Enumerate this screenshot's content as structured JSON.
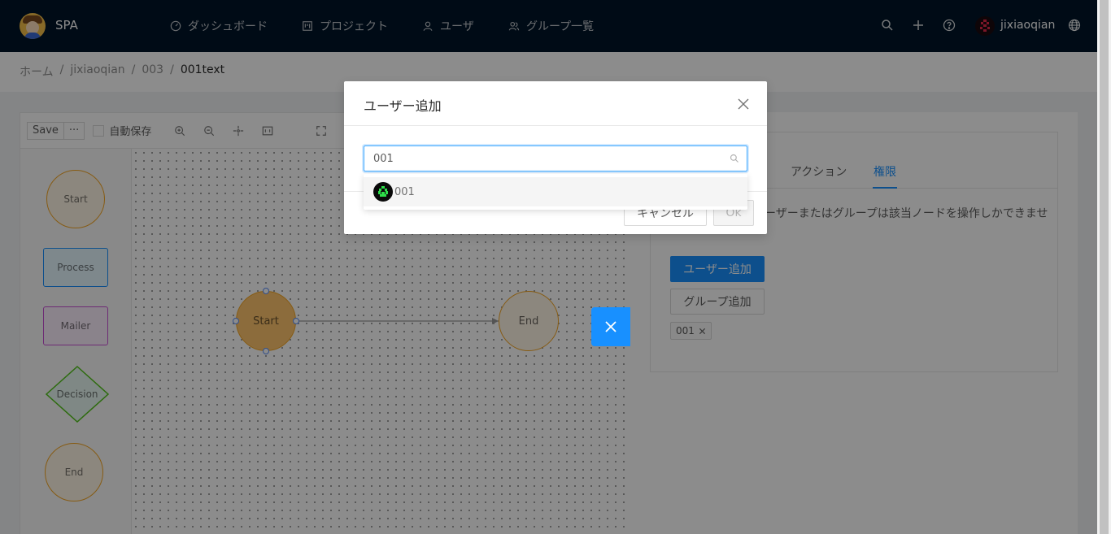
{
  "header": {
    "app_title": "SPA",
    "nav": [
      {
        "label": "ダッシュボード",
        "icon": "dashboard-icon"
      },
      {
        "label": "プロジェクト",
        "icon": "project-icon"
      },
      {
        "label": "ユーザ",
        "icon": "user-icon"
      },
      {
        "label": "グループ一覧",
        "icon": "group-icon"
      }
    ],
    "username": "jixiaoqian"
  },
  "breadcrumb": [
    "ホーム",
    "jixiaoqian",
    "003",
    "001text"
  ],
  "editor": {
    "toolbar": {
      "save_label": "Save",
      "more_label": "···",
      "autosave_label": "自動保存"
    },
    "palette": [
      "Start",
      "Process",
      "Mailer",
      "Decision",
      "End"
    ],
    "canvas": {
      "start_label": "Start",
      "end_label": "End"
    }
  },
  "right_panel": {
    "tabs": [
      "アクション",
      "権限"
    ],
    "active_tab": "権限",
    "description": "ーザーまたはグループは該当ノードを操作しかできませ",
    "add_user_label": "ユーザー追加",
    "add_group_label": "グループ追加",
    "tags": [
      "001"
    ]
  },
  "modal": {
    "title": "ユーザー追加",
    "search_value": "001",
    "options": [
      {
        "label": "001"
      }
    ],
    "cancel_label": "キャンセル",
    "ok_label": "Ok"
  },
  "colors": {
    "header_bg": "#001529",
    "primary": "#1890ff"
  }
}
